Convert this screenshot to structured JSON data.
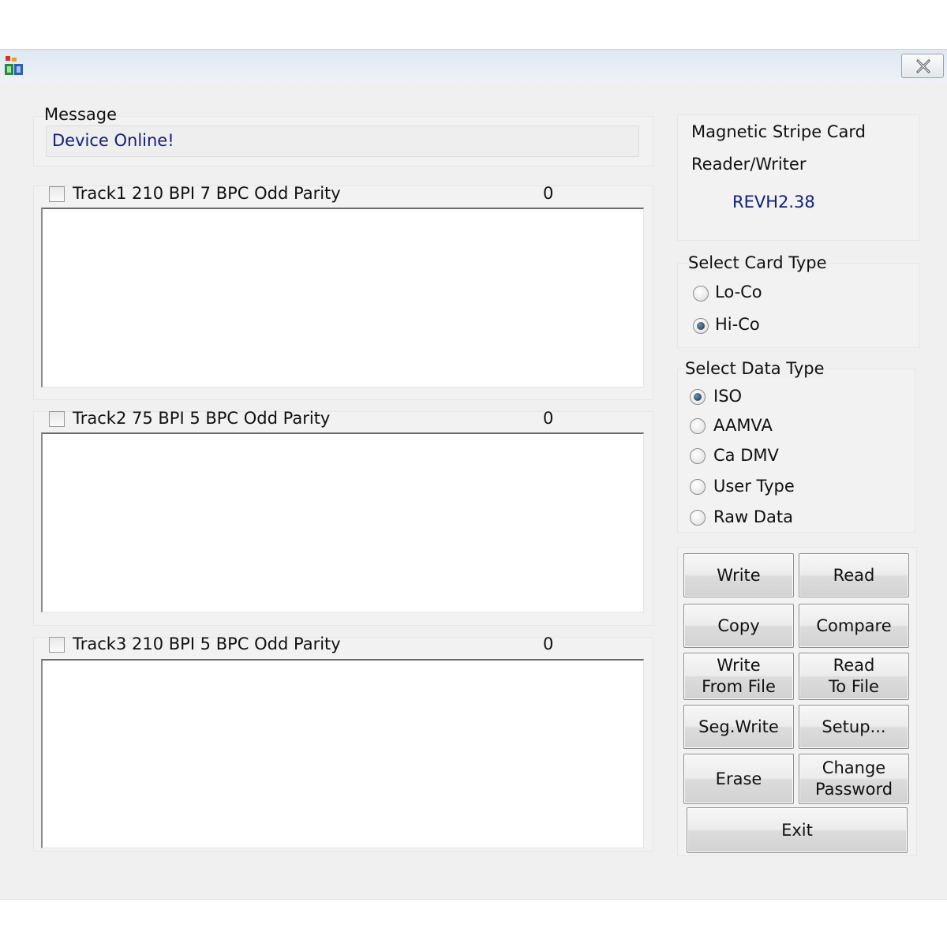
{
  "message": {
    "label": "Message",
    "text": "Device Online!"
  },
  "tracks": [
    {
      "label": "Track1  210 BPI  7 BPC  Odd Parity",
      "count": "0"
    },
    {
      "label": "Track2  75 BPI  5 BPC  Odd Parity",
      "count": "0"
    },
    {
      "label": "Track3  210 BPI  5 BPC  Odd Parity",
      "count": "0"
    }
  ],
  "device": {
    "line1": "Magnetic Stripe Card",
    "line2": "Reader/Writer",
    "version": "REVH2.38"
  },
  "card_type": {
    "label": "Select Card Type",
    "options": [
      "Lo-Co",
      "Hi-Co"
    ],
    "selected": "Hi-Co"
  },
  "data_type": {
    "label": "Select Data Type",
    "options": [
      "ISO",
      "AAMVA",
      "Ca DMV",
      "User Type",
      "Raw Data"
    ],
    "selected": "ISO"
  },
  "buttons": {
    "write": "Write",
    "read": "Read",
    "copy": "Copy",
    "compare": "Compare",
    "write_from_file": "Write\nFrom File",
    "read_to_file": "Read\nTo File",
    "seg_write": "Seg.Write",
    "setup": "Setup...",
    "erase": "Erase",
    "change_password": "Change\nPassword",
    "exit": "Exit"
  },
  "colors": {
    "accent_text": "#14207c",
    "window_bg": "#f0f0f0",
    "titlebar": "#e4ebf2"
  },
  "icons": {
    "app": "app-icon",
    "close": "close-icon"
  }
}
